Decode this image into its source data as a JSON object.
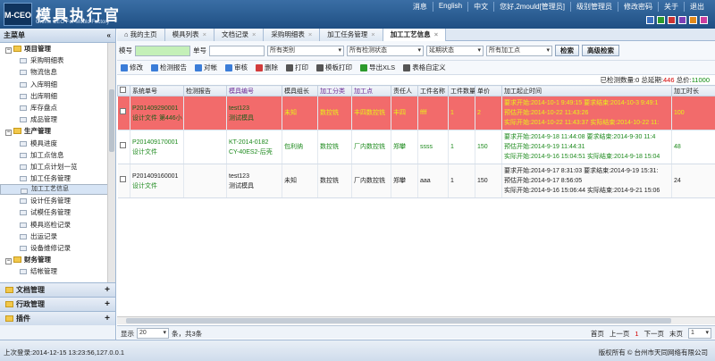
{
  "header": {
    "logo_text": "M-CEO",
    "title": "模具执行官",
    "subtitle": "Online CEO For Mould Factory",
    "links": [
      "消息",
      "English",
      "中文",
      "您好,2mould[管理员]",
      "级别管理员",
      "修改密码",
      "关于",
      "退出"
    ],
    "swatch_colors": [
      "#3b6fbf",
      "#2c9a2c",
      "#cc3333",
      "#7a3fb8",
      "#e38a1a",
      "#cc3f9f"
    ]
  },
  "sidebar": {
    "title": "主菜单",
    "collapse_glyph": "«",
    "groups": [
      {
        "label": "项目管理",
        "items": [
          "采购明细表",
          "物流信息",
          "入库明细",
          "出库明细",
          "库存盘点",
          "成品管理"
        ]
      },
      {
        "label": "生产管理",
        "items": [
          "模具进度",
          "加工点信息",
          "加工点计划一览",
          "加工任务管理",
          "加工工艺信息",
          "设计任务管理",
          "试模任务管理",
          "模具巡检记录",
          "出运记录",
          "设备维修记录"
        ]
      },
      {
        "label": "财务管理",
        "items": [
          "结帐管理"
        ]
      }
    ],
    "sections": [
      "文档管理",
      "行政管理",
      "插件"
    ],
    "section_glyph": "+"
  },
  "tabs": [
    {
      "label": "我的主页",
      "active": false,
      "icon": true
    },
    {
      "label": "模具列表",
      "active": false
    },
    {
      "label": "文档记录",
      "active": false
    },
    {
      "label": "采购明细表",
      "active": false
    },
    {
      "label": "加工任务管理",
      "active": false
    },
    {
      "label": "加工工艺信息",
      "active": true
    }
  ],
  "tab_close_glyph": "×",
  "search": {
    "mold_label": "模号",
    "mold_value": "",
    "order_label": "单号",
    "order_value": "",
    "category": "所有类别",
    "inspection": "所有检测状态",
    "delay": "延期状态",
    "site": "所有加工点",
    "search_button": "检索",
    "advanced_button": "高级检索"
  },
  "toolbar": [
    {
      "label": "修改",
      "icon": "edit-icon",
      "color": "#3b7dd8"
    },
    {
      "label": "检测报告",
      "icon": "report-icon",
      "color": "#3b7dd8"
    },
    {
      "label": "对帐",
      "icon": "check-icon",
      "color": "#3b7dd8"
    },
    {
      "label": "审核",
      "icon": "approve-icon",
      "color": "#3b7dd8"
    },
    {
      "label": "删除",
      "icon": "delete-icon",
      "color": "#d23b3b"
    },
    {
      "label": "打印",
      "icon": "print-icon",
      "color": "#555555"
    },
    {
      "label": "模板打印",
      "icon": "template-print-icon",
      "color": "#555555"
    },
    {
      "label": "导出XLS",
      "icon": "export-icon",
      "color": "#2c9a2c"
    },
    {
      "label": "表格自定义",
      "icon": "table-settings-icon",
      "color": "#555555"
    }
  ],
  "summary": {
    "checked_label": "已检测数量:",
    "checked": "0",
    "delayed_label": "总延期:",
    "delayed": "446",
    "total_label": "总价:",
    "total": "11000"
  },
  "columns": [
    "系统单号",
    "检测报告",
    "模具编号",
    "模具组长",
    "加工分类",
    "加工点",
    "责任人",
    "工件名称",
    "工件数量",
    "单价",
    "加工起止时间",
    "加工时长"
  ],
  "rows": [
    {
      "style": "red",
      "sys_no": [
        "P201409290001",
        "设计文件 第446小"
      ],
      "report": "",
      "mold_no": [
        "test123",
        "测试模具"
      ],
      "leader": "未知",
      "category": "数控铣",
      "site": "丰四数控铣",
      "person": "丰四",
      "part": "ffff",
      "qty": "1",
      "price": "2",
      "times": [
        "要求开始:2014-10-1 9:49:15 要求结束:2014-10-3 9:49:1",
        "预估开始:2014-10-22 11:43:26",
        "实际开始:2014-10-22 11:43:37 实际结束:2014-10-22 11:"
      ],
      "duration": "100"
    },
    {
      "style": "white",
      "sys_no": [
        "P201409170001",
        "设计文件"
      ],
      "report": "",
      "mold_no": [
        "KT-2014-0182",
        "CY-40ES2-后壳"
      ],
      "leader": "包利纳",
      "category": "数控铣",
      "site": "厂内数控铣",
      "person": "郑攀",
      "part": "ssss",
      "qty": "1",
      "price": "150",
      "times": [
        "要求开始:2014-9-18 11:44:08 要求结束:2014-9-30 11:4",
        "预估开始:2014-9-19 11:44:31",
        "实际开始:2014-9-16 15:04:51 实际结束:2014-9-18 15:04"
      ],
      "duration": "48"
    },
    {
      "style": "gray",
      "sys_no": [
        "P201409160001",
        "设计文件"
      ],
      "report": "",
      "mold_no": [
        "test123",
        "测试模具"
      ],
      "leader": "未知",
      "category": "数控铣",
      "site": "厂内数控铣",
      "person": "郑攀",
      "part": "aaa",
      "qty": "1",
      "price": "150",
      "times": [
        "要求开始:2014-9-17 8:31:03 要求结束:2014-9-19 15:31:",
        "预估开始:2014-9-17 8:56:05",
        "实际开始:2014-9-16 15:06:44 实际结束:2014-9-21 15:06"
      ],
      "duration": "24"
    }
  ],
  "pager": {
    "show_label": "显示",
    "page_size": "20",
    "summary": "条，共3条",
    "first": "首页",
    "prev": "上一页",
    "current": "1",
    "next": "下一页",
    "last": "末页",
    "goto": "1"
  },
  "footer": {
    "last_login": "上次登录:2014-12-15 13:23:56,127.0.0.1",
    "copyright": "版权所有 © 台州市天同网络有限公司"
  }
}
